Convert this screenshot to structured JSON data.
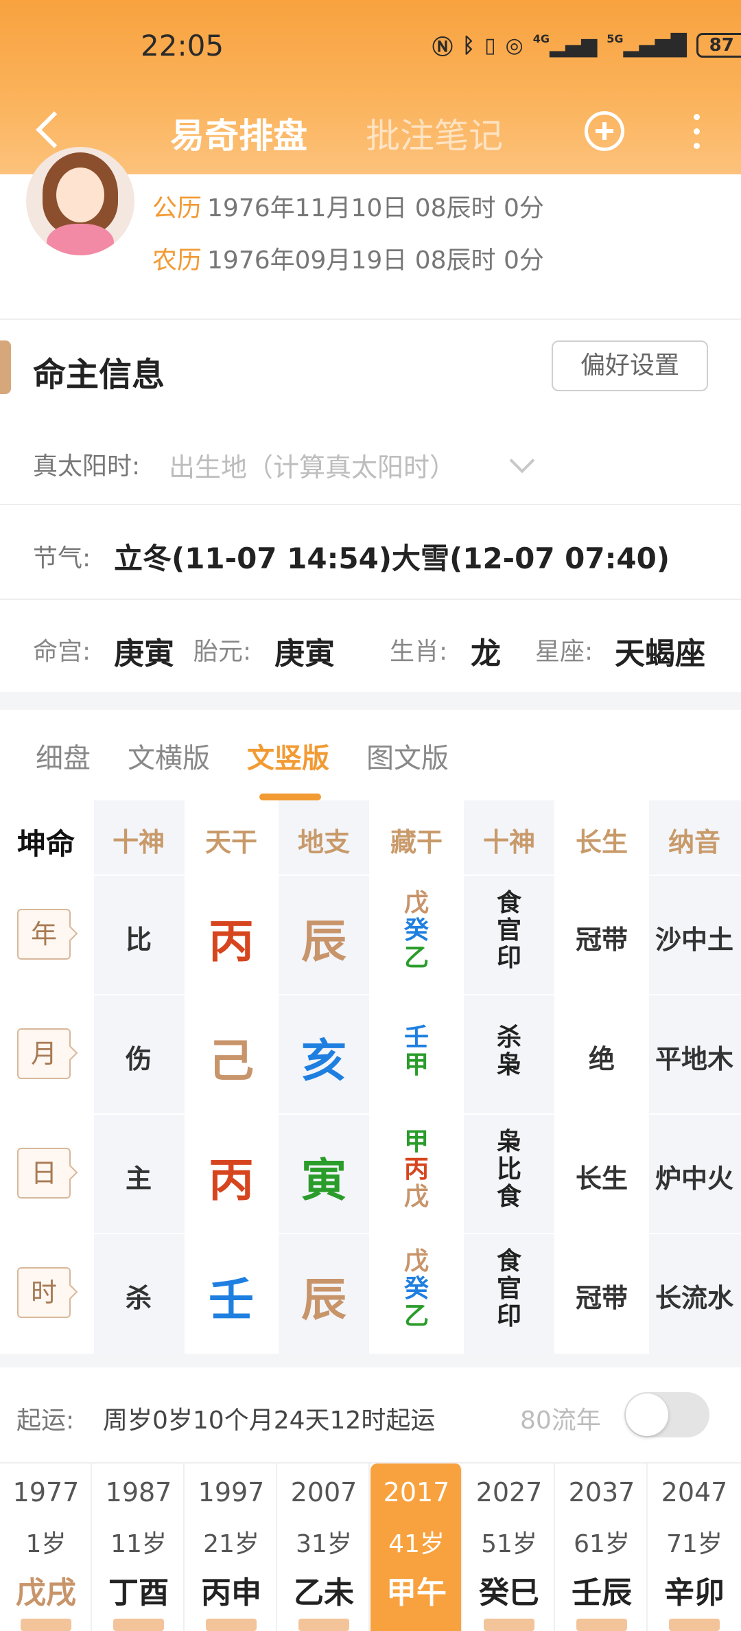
{
  "status_bar": {
    "time": "22:05",
    "icons": [
      "nfc-icon",
      "bluetooth-icon",
      "vibrate-icon",
      "hotspot-icon",
      "signal-4g-icon",
      "signal-5g-icon"
    ],
    "net1": "4G",
    "net2": "5G",
    "battery": "87"
  },
  "nav": {
    "tab_active": "易奇排盘",
    "tab_inactive": "批注笔记"
  },
  "profile": {
    "solar_tag": "公历",
    "solar_date": "1976年11月10日 08辰时 0分",
    "lunar_tag": "农历",
    "lunar_date": "1976年09月19日 08辰时 0分"
  },
  "info": {
    "title": "命主信息",
    "pref_button": "偏好设置",
    "solar_time_label": "真太阳时:",
    "solar_time_placeholder": "出生地（计算真太阳时）",
    "jieqi_label": "节气:",
    "jieqi_value": "立冬(11-07 14:54)大雪(12-07 07:40)",
    "minggong_label": "命宫:",
    "minggong_value": "庚寅",
    "taiyuan_label": "胎元:",
    "taiyuan_value": "庚寅",
    "shengxiao_label": "生肖:",
    "shengxiao_value": "龙",
    "xingzuo_label": "星座:",
    "xingzuo_value": "天蝎座"
  },
  "view_tabs": [
    "细盘",
    "文横版",
    "文竖版",
    "图文版"
  ],
  "view_tab_active": 2,
  "chart": {
    "corner": "坤命",
    "headers": [
      "十神",
      "天干",
      "地支",
      "藏干",
      "十神",
      "长生",
      "纳音"
    ],
    "rows": [
      {
        "pillar": "年",
        "shishen": "比",
        "gan": "丙",
        "zhi": "辰",
        "canggan": [
          "戊",
          "癸",
          "乙"
        ],
        "canggan_shishen": [
          "食",
          "官",
          "印"
        ],
        "changsheng": "冠带",
        "nayin": "沙中土"
      },
      {
        "pillar": "月",
        "shishen": "伤",
        "gan": "己",
        "zhi": "亥",
        "canggan": [
          "壬",
          "甲"
        ],
        "canggan_shishen": [
          "杀",
          "枭"
        ],
        "changsheng": "绝",
        "nayin": "平地木"
      },
      {
        "pillar": "日",
        "shishen": "主",
        "gan": "丙",
        "zhi": "寅",
        "canggan": [
          "甲",
          "丙",
          "戊"
        ],
        "canggan_shishen": [
          "枭",
          "比",
          "食"
        ],
        "changsheng": "长生",
        "nayin": "炉中火"
      },
      {
        "pillar": "时",
        "shishen": "杀",
        "gan": "壬",
        "zhi": "辰",
        "canggan": [
          "戊",
          "癸",
          "乙"
        ],
        "canggan_shishen": [
          "食",
          "官",
          "印"
        ],
        "changsheng": "冠带",
        "nayin": "长流水"
      }
    ],
    "colors": {
      "fire": "#d6451e",
      "earth": "#c8946a",
      "water": "#1f7fe0",
      "wood": "#2a9c2a"
    }
  },
  "qiyun": {
    "label": "起运:",
    "value": "周岁0岁10个月24天12时起运",
    "liunian_label": "80流年",
    "toggle_on": false
  },
  "dayun": [
    {
      "year": "1977",
      "age": "1岁",
      "ganzhi": "戊戌",
      "active": false
    },
    {
      "year": "1987",
      "age": "11岁",
      "ganzhi": "丁酉",
      "active": false
    },
    {
      "year": "1997",
      "age": "21岁",
      "ganzhi": "丙申",
      "active": false
    },
    {
      "year": "2007",
      "age": "31岁",
      "ganzhi": "乙未",
      "active": false
    },
    {
      "year": "2017",
      "age": "41岁",
      "ganzhi": "甲午",
      "active": true
    },
    {
      "year": "2027",
      "age": "51岁",
      "ganzhi": "癸巳",
      "active": false
    },
    {
      "year": "2037",
      "age": "61岁",
      "ganzhi": "壬辰",
      "active": false
    },
    {
      "year": "2047",
      "age": "71岁",
      "ganzhi": "辛卯",
      "active": false
    }
  ],
  "accent_color": "#f29a33"
}
